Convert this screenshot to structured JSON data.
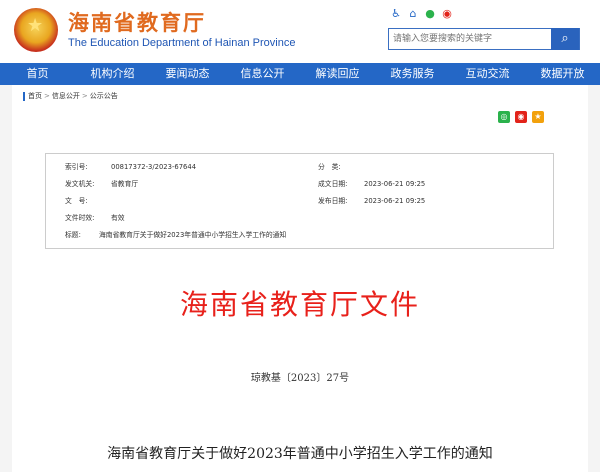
{
  "header": {
    "title": "海南省教育厅",
    "subtitle": "The Education Department of Hainan Province",
    "tool_icons": [
      "accessibility-icon",
      "elder-mode-icon",
      "wechat-icon",
      "weibo-icon"
    ],
    "search_placeholder": "请输入您要搜索的关键字",
    "search_icon": "search-icon"
  },
  "nav": {
    "items": [
      "首页",
      "机构介绍",
      "要闻动态",
      "信息公开",
      "解读回应",
      "政务服务",
      "互动交流",
      "数据开放"
    ]
  },
  "breadcrumb": [
    "首页",
    "信息公开",
    "公示公告"
  ],
  "share": [
    "wechat-share-icon",
    "weibo-share-icon",
    "favorite-icon"
  ],
  "meta": {
    "index_label": "索引号:",
    "index_value": "00817372-3/2023-67644",
    "category_label": "分　类:",
    "category_value": "",
    "issuer_label": "发文机关:",
    "issuer_value": "省教育厅",
    "created_label": "成文日期:",
    "created_value": "2023-06-21 09:25",
    "docno_label": "文　号:",
    "docno_value": "",
    "published_label": "发布日期:",
    "published_value": "2023-06-21 09:25",
    "validity_label": "文件时效:",
    "validity_value": "有效",
    "subject_label": "标题:",
    "subject_value": "海南省教育厅关于做好2023年普通中小学招生入学工作的通知"
  },
  "document": {
    "header": "海南省教育厅文件",
    "number": "琼教基〔2023〕27号",
    "title": "海南省教育厅关于做好2023年普通中小学招生入学工作的通知"
  },
  "colors": {
    "nav_blue": "#2467c6",
    "title_orange": "#e06a1f",
    "doc_red": "#e8211b"
  }
}
